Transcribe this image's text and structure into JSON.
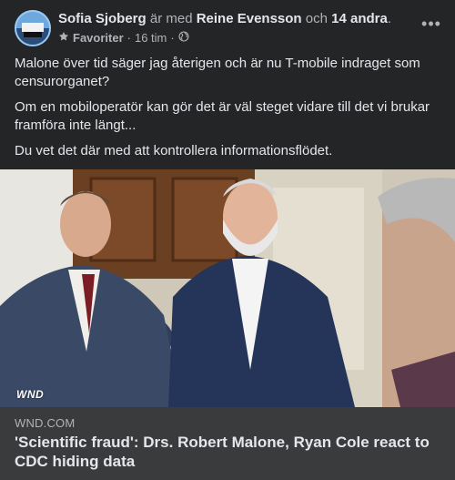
{
  "post": {
    "author": "Sofia Sjoberg",
    "with_text": " är med ",
    "tagged": "Reine Evensson",
    "and_text": " och ",
    "others": "14 andra",
    "period": ".",
    "favorites_label": "Favoriter",
    "separator": "·",
    "time": "16 tim",
    "more_label": "•••",
    "paragraphs": [
      "Malone över tid säger jag återigen och är nu T-mobile indraget som censurorganet?",
      "Om en mobiloperatör kan gör det är väl steget vidare till det vi brukar framföra inte längt...",
      "Du vet det där med att kontrollera informationsflödet."
    ]
  },
  "link_preview": {
    "watermark": "WND",
    "domain": "WND.COM",
    "headline": "'Scientific fraud': Drs. Robert Malone, Ryan Cole react to CDC hiding data"
  },
  "colors": {
    "background": "#242526",
    "link_card": "#3a3b3c",
    "primary_text": "#e4e6eb",
    "secondary_text": "#b0b3b8"
  },
  "icons": {
    "favorite": "star-icon",
    "audience": "globe-icon",
    "menu": "more-horizontal-icon"
  }
}
